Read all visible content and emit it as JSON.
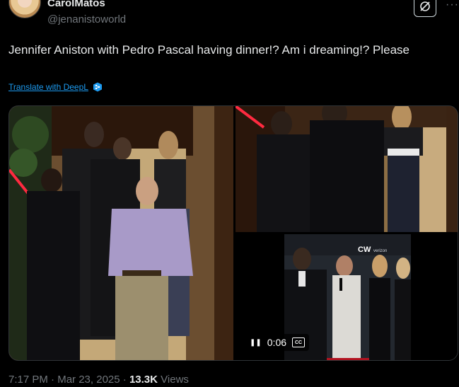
{
  "author": {
    "display_name": "CarolMatos",
    "handle": "@jenanistoworld"
  },
  "header_actions": {
    "grok_icon": "grok-slash-icon",
    "more_icon": "more-dots-icon",
    "more_glyph": "···"
  },
  "tweet": {
    "text": "Jennifer Aniston with Pedro Pascal having dinner!? Am i dreaming!? Please",
    "translate_label": "Translate with DeepL"
  },
  "media": {
    "video": {
      "time": "0:06",
      "pause_glyph": "❚❚",
      "cc_label": "CC",
      "banner_text": "CW",
      "verizon_text": "verizon"
    }
  },
  "footer": {
    "time": "7:17 PM",
    "separator": "·",
    "date": "Mar 23, 2025",
    "views_count": "13.3K",
    "views_label": "Views"
  },
  "colors": {
    "accent": "#1d9bf0",
    "muted": "#71767b",
    "text": "#e7e9ea",
    "background": "#000000"
  }
}
